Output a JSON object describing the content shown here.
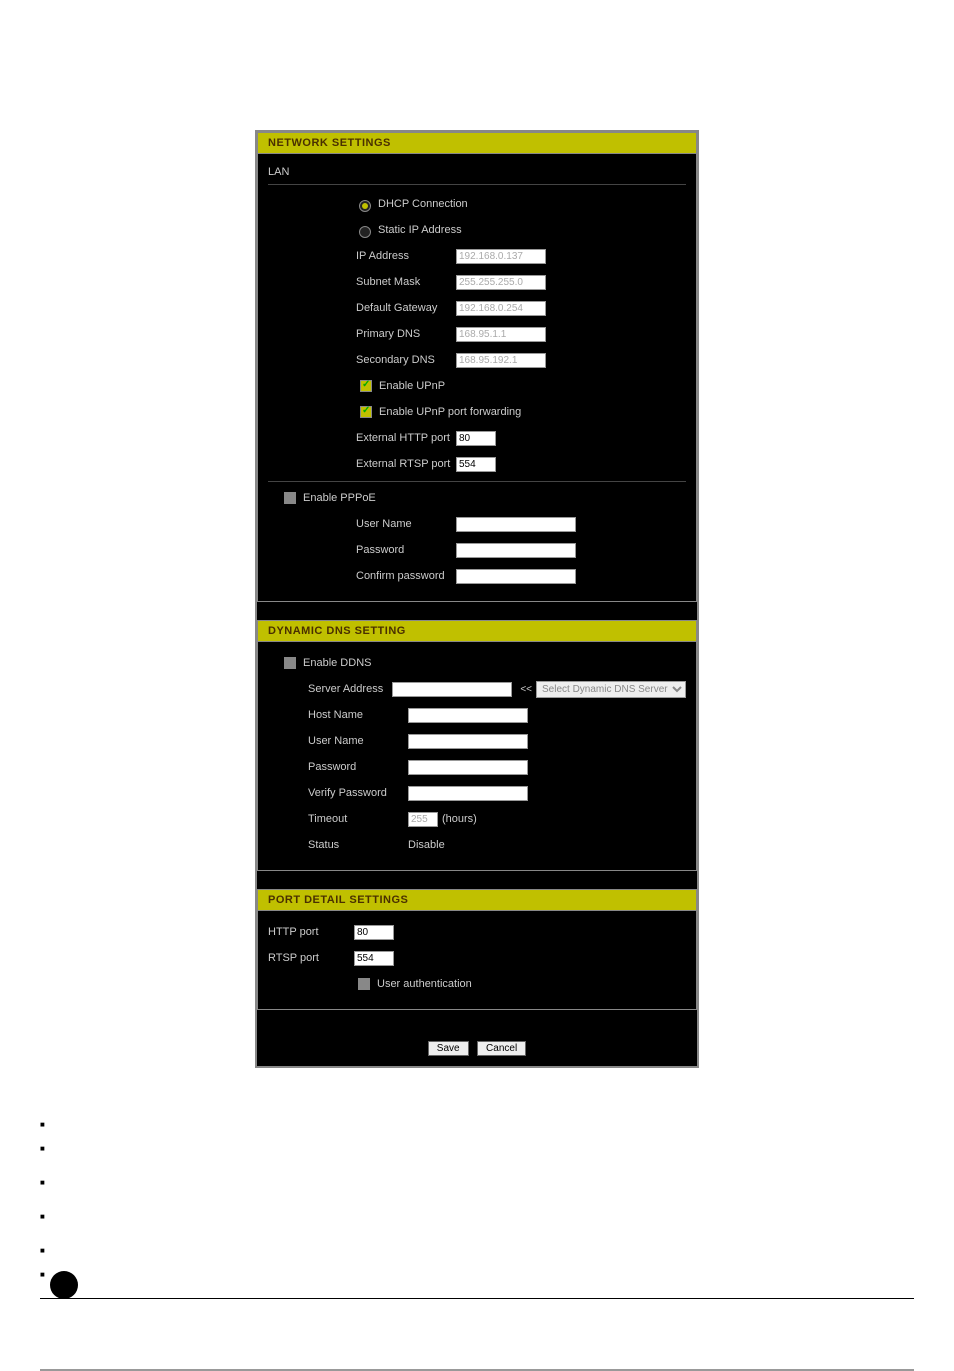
{
  "network": {
    "header": "NETWORK SETTINGS",
    "lan_title": "LAN",
    "dhcp_label": "DHCP Connection",
    "static_label": "Static IP Address",
    "ip_address_label": "IP Address",
    "ip_address_value": "192.168.0.137",
    "subnet_label": "Subnet Mask",
    "subnet_value": "255.255.255.0",
    "gateway_label": "Default Gateway",
    "gateway_value": "192.168.0.254",
    "pdns_label": "Primary DNS",
    "pdns_value": "168.95.1.1",
    "sdns_label": "Secondary DNS",
    "sdns_value": "168.95.192.1",
    "upnp_label": "Enable UPnP",
    "upnp_fwd_label": "Enable UPnP port forwarding",
    "ext_http_label": "External HTTP port",
    "ext_http_value": "80",
    "ext_rtsp_label": "External RTSP port",
    "ext_rtsp_value": "554",
    "pppoe_label": "Enable PPPoE",
    "user_label": "User Name",
    "pass_label": "Password",
    "confirm_label": "Confirm password"
  },
  "ddns": {
    "header": "DYNAMIC DNS SETTING",
    "enable_label": "Enable DDNS",
    "server_label": "Server Address",
    "arrow": "<<",
    "select_placeholder": "Select Dynamic DNS Server",
    "host_label": "Host Name",
    "user_label": "User Name",
    "pass_label": "Password",
    "verify_label": "Verify Password",
    "timeout_label": "Timeout",
    "timeout_value": "255",
    "timeout_unit": "(hours)",
    "status_label": "Status",
    "status_value": "Disable"
  },
  "port": {
    "header": "PORT DETAIL SETTINGS",
    "http_label": "HTTP port",
    "http_value": "80",
    "rtsp_label": "RTSP port",
    "rtsp_value": "554",
    "auth_label": "User authentication"
  },
  "buttons": {
    "save": "Save",
    "cancel": "Cancel"
  }
}
